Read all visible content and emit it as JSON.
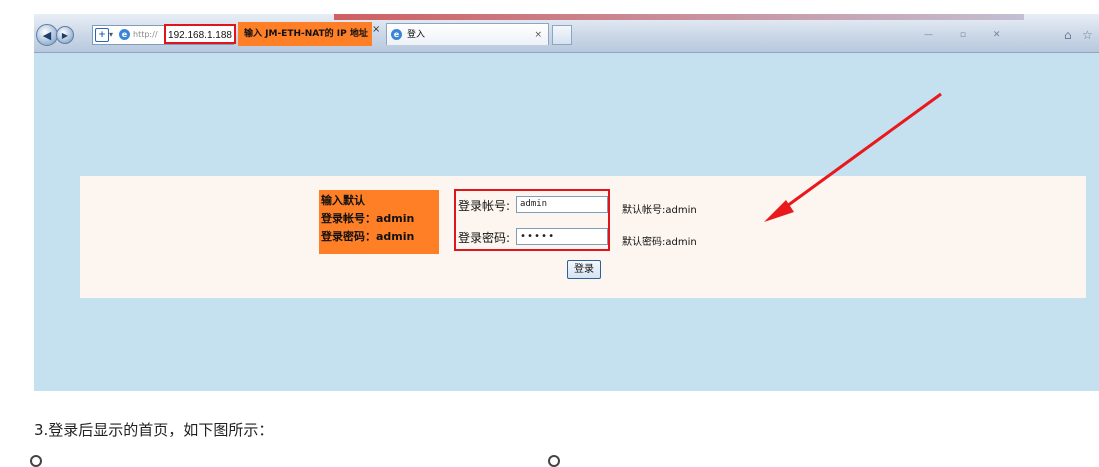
{
  "browser": {
    "address_proto": "http://",
    "address_ip": "192.168.1.188",
    "address_annotation": "输入 JM-ETH-NAT的 IP 地址",
    "tab_title": "登入",
    "tab_close": "×"
  },
  "login": {
    "annotation_lines": [
      "输入默认",
      "登录帐号：admin",
      "登录密码：admin"
    ],
    "user_label": "登录帐号:",
    "user_value": "admin",
    "pass_label": "登录密码:",
    "pass_value": "•••••",
    "user_hint": "默认帐号:admin",
    "pass_hint": "默认密码:admin",
    "submit_label": "登录"
  },
  "caption": "3.登录后显示的首页，如下图所示：",
  "colors": {
    "page_bg": "#c5e0ee",
    "annotation_orange": "#ff7f27",
    "highlight_red": "#e0141c"
  }
}
